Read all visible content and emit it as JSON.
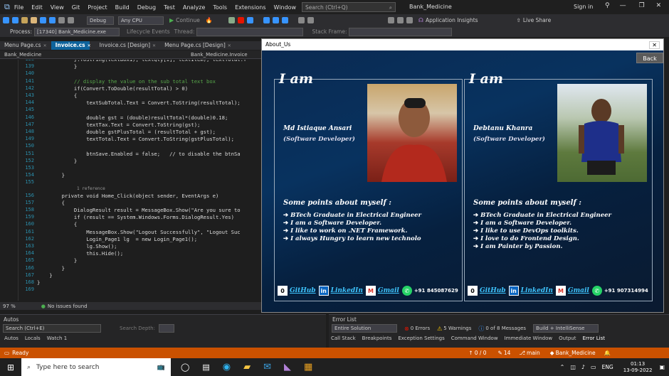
{
  "titlebar": {
    "menus": [
      "File",
      "Edit",
      "View",
      "Git",
      "Project",
      "Build",
      "Debug",
      "Test",
      "Analyze",
      "Tools",
      "Extensions",
      "Window",
      "Help"
    ],
    "search_placeholder": "Search (Ctrl+Q)",
    "solution": "Bank_Medicine",
    "signin": "Sign in"
  },
  "toolbar": {
    "config": "Debug",
    "platform": "Any CPU",
    "continue": "Continue",
    "app_insights": "Application Insights",
    "live_share": "Live Share",
    "process_label": "Process:",
    "process": "[17340] Bank_Medicine.exe",
    "lifecycle": "Lifecycle Events",
    "thread": "Thread:",
    "stack": "Stack Frame:"
  },
  "tabs": [
    {
      "label": "Menu Page.cs",
      "active": false
    },
    {
      "label": "Invoice.cs",
      "active": true
    },
    {
      "label": "Invoice.cs [Design]",
      "active": false
    },
    {
      "label": "Menu Page.cs [Design]",
      "active": false
    }
  ],
  "nav": {
    "left": "Bank_Medicine",
    "right": "Bank_Medicine.Invoice"
  },
  "code_lines": [
    {
      "n": "138",
      "text": "            }.ToString(textBox1), textQty[i], textItem), textTotal.T"
    },
    {
      "n": "139",
      "text": "            }"
    },
    {
      "n": "140",
      "text": ""
    },
    {
      "n": "141",
      "text": "            // display the value on the sub total text box"
    },
    {
      "n": "142",
      "text": "            if(Convert.ToDouble(resultTotal) > 0)"
    },
    {
      "n": "143",
      "text": "            {"
    },
    {
      "n": "144",
      "text": "                textSubTotal.Text = Convert.ToString(resultTotal);"
    },
    {
      "n": "145",
      "text": ""
    },
    {
      "n": "146",
      "text": "                double gst = (double)resultTotal*(double)0.18;"
    },
    {
      "n": "147",
      "text": "                textTax.Text = Convert.ToString(gst);"
    },
    {
      "n": "148",
      "text": "                double gstPlusTotal = (resultTotal + gst);"
    },
    {
      "n": "149",
      "text": "                textTotal.Text = Convert.ToString(gstPlusTotal);"
    },
    {
      "n": "150",
      "text": ""
    },
    {
      "n": "151",
      "text": "                btnSave.Enabled = false;   // to disable the btnSa"
    },
    {
      "n": "152",
      "text": "            }"
    },
    {
      "n": "153",
      "text": ""
    },
    {
      "n": "154",
      "text": "        }"
    },
    {
      "n": "155",
      "text": ""
    },
    {
      "n": "156",
      "text": "        private void Home_Click(object sender, EventArgs e)"
    },
    {
      "n": "157",
      "text": "        {"
    },
    {
      "n": "158",
      "text": "            DialogResult result = MessageBox.Show(\"Are you sure to"
    },
    {
      "n": "159",
      "text": "            if (result == System.Windows.Forms.DialogResult.Yes)"
    },
    {
      "n": "160",
      "text": "            {"
    },
    {
      "n": "161",
      "text": "                MessageBox.Show(\"Logout Successfully\", \"Logout Suc"
    },
    {
      "n": "162",
      "text": "                Login_Page1 lg  = new Login_Page1();"
    },
    {
      "n": "163",
      "text": "                lg.Show();"
    },
    {
      "n": "164",
      "text": "                this.Hide();"
    },
    {
      "n": "165",
      "text": "            }"
    },
    {
      "n": "166",
      "text": "        }"
    },
    {
      "n": "167",
      "text": "    }"
    },
    {
      "n": "168",
      "text": "}"
    },
    {
      "n": "169",
      "text": ""
    }
  ],
  "reference_hint": "1 reference",
  "editor_status": {
    "zoom": "97 %",
    "issues": "No issues found"
  },
  "about": {
    "title": "About_Us",
    "back": "Back",
    "cards": [
      {
        "iam": "I am",
        "name": "Md Istiaque Ansari",
        "role": "(Software Developer)",
        "points_title": "Some points about myself :",
        "points": [
          "BTech Graduate in Electrical Engineer",
          "I am a Software Developer.",
          "I like to work on .NET Framework.",
          "I always Hungry to learn new technolo"
        ],
        "github": "GitHub",
        "linkedin": "LinkedIn",
        "gmail": "Gmail",
        "phone": "+91 845087629"
      },
      {
        "iam": "I am",
        "name": "Debtanu Khanra",
        "role": "(Software Developer)",
        "points_title": "Some points about myself :",
        "points": [
          "BTech Graduate in Electrical Engineer",
          "I am a Software Developer.",
          "I like to use DevOps toolkits.",
          "I love to do Frontend Design.",
          "I am Painter by Passion."
        ],
        "github": "GitHub",
        "linkedin": "LinkedIn",
        "gmail": "Gmail",
        "phone": "+91 907314994"
      }
    ]
  },
  "autos": {
    "title": "Autos",
    "search": "Search (Ctrl+E)",
    "depth": "Search Depth:",
    "tabs": [
      "Autos",
      "Locals",
      "Watch 1"
    ]
  },
  "errorlist": {
    "title": "Error List",
    "scope": "Entire Solution",
    "errors": "0 Errors",
    "warnings": "5 Warnings",
    "messages": "0 of 8 Messages",
    "build": "Build + IntelliSense",
    "tabs": [
      "Call Stack",
      "Breakpoints",
      "Exception Settings",
      "Command Window",
      "Immediate Window",
      "Output",
      "Error List"
    ]
  },
  "statusbar": {
    "ready": "Ready",
    "lines": "0 / 0",
    "changes": "14",
    "branch": "main",
    "repo": "Bank_Medicine"
  },
  "taskbar": {
    "search": "Type here to search",
    "lang": "ENG",
    "time": "01:13",
    "date": "13-09-2022"
  },
  "colors": {
    "accent": "#0e639c",
    "status": "#ca5100",
    "about_bg": "#08325f",
    "link": "#3ec5ff"
  }
}
